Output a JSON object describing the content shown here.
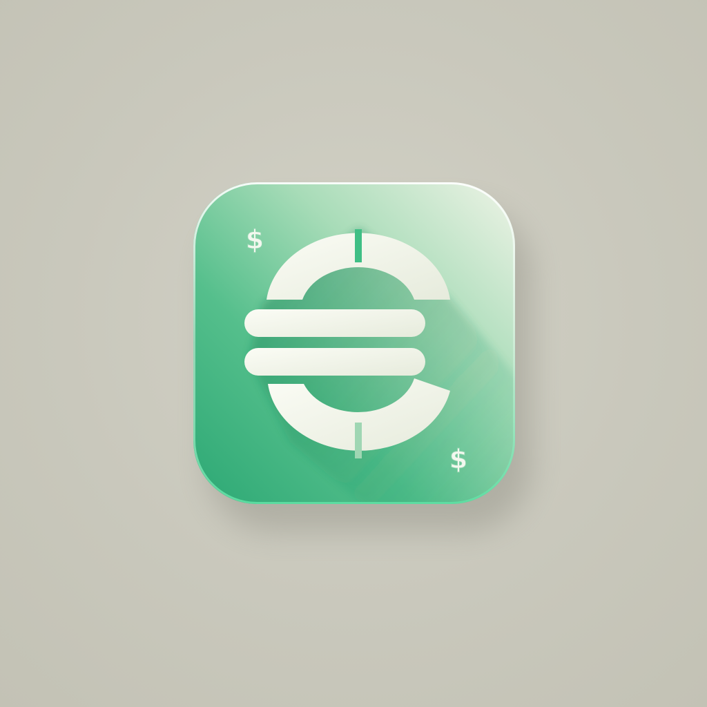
{
  "icon": {
    "name": "euro-currency-app-icon",
    "symbol": "€",
    "decorations": [
      {
        "glyph": "$"
      },
      {
        "glyph": "$"
      }
    ]
  },
  "colors": {
    "background": "#cbcabe",
    "tile_top": "#e4eedd",
    "tile_mid": "#57c08f",
    "tile_bottom": "#2faa76",
    "symbol_fill": "#f2f3ea",
    "symbol_accent": "#3fbf85",
    "shadow": "#1f8c5e"
  }
}
